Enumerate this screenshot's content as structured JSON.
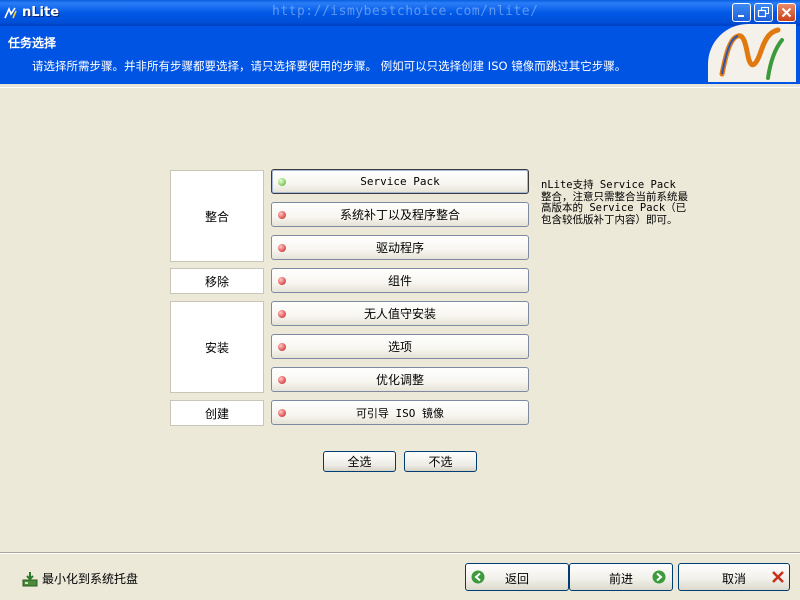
{
  "window": {
    "title": "nLite",
    "url_watermark": "http://ismybestchoice.com/nlite/"
  },
  "header": {
    "title": "任务选择",
    "description": "请选择所需步骤。并非所有步骤都要选择，请只选择要使用的步骤。 例如可以只选择创建 ISO 镜像而跳过其它步骤。"
  },
  "categories": {
    "integrate": "整合",
    "remove": "移除",
    "setup": "安装",
    "create": "创建"
  },
  "steps": [
    {
      "label": "Service Pack",
      "selected": true
    },
    {
      "label": "系统补丁以及程序整合",
      "selected": false
    },
    {
      "label": "驱动程序",
      "selected": false
    },
    {
      "label": "组件",
      "selected": false
    },
    {
      "label": "无人值守安装",
      "selected": false
    },
    {
      "label": "选项",
      "selected": false
    },
    {
      "label": "优化调整",
      "selected": false
    },
    {
      "label": "可引导 ISO 镜像",
      "selected": false
    }
  ],
  "info_text": "nLite支持 Service Pack 整合，注意只需整合当前系统最高版本的 Service Pack（已包含较低版补丁内容）即可。",
  "selection": {
    "select_all": "全选",
    "select_none": "不选"
  },
  "footer": {
    "minimize_to_tray": "最小化到系统托盘",
    "back": "返回",
    "next": "前进",
    "cancel": "取消"
  },
  "colors": {
    "header_bg": "#0054e3",
    "indicator_on": "#8fcf6b",
    "indicator_off": "#e15a5a",
    "window_bg": "#ece9d8"
  }
}
